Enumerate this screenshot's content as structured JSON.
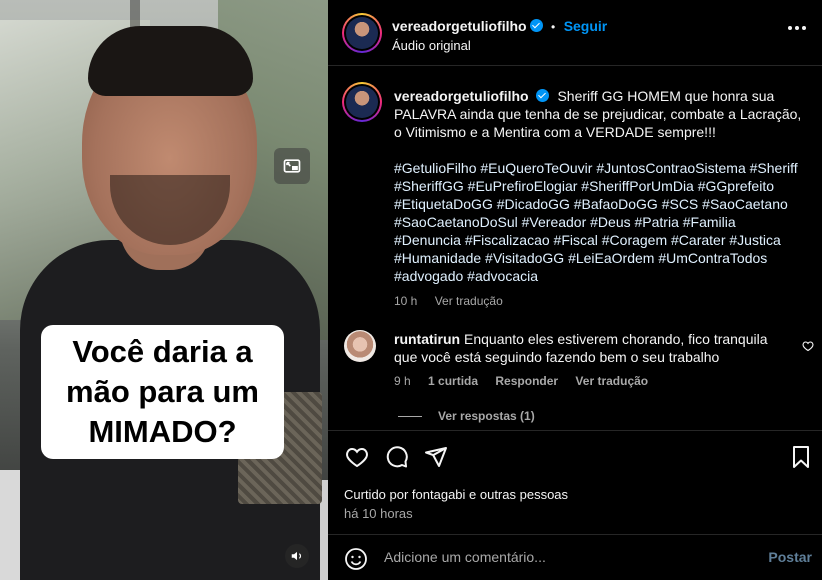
{
  "video": {
    "overlay_caption": "Você daria a\nmão para um\nMIMADO?"
  },
  "header": {
    "username": "vereadorgetuliofilho",
    "separator": "•",
    "follow_label": "Seguir",
    "audio_label": "Áudio original"
  },
  "post": {
    "username": "vereadorgetuliofilho",
    "caption": "Sheriff GG HOMEM que honra sua PALAVRA ainda que tenha de se prejudicar, combate a Lacração, o Vitimismo e a Mentira com a VERDADE sempre!!!",
    "hashtags": "#GetulioFilho #EuQueroTeOuvir #JuntosContraoSistema #Sheriff #SheriffGG #EuPrefiroElogiar #SheriffPorUmDia #GGprefeito #EtiquetaDoGG #DicadoGG #BafaoDoGG #SCS #SaoCaetano #SaoCaetanoDoSul #Vereador #Deus #Patria #Familia #Denuncia #Fiscalizacao #Fiscal #Coragem #Carater #Justica #Humanidade #VisitadoGG #LeiEaOrdem #UmContraTodos #advogado #advocacia",
    "age": "10 h",
    "translate_label": "Ver tradução"
  },
  "comment": {
    "username": "runtatirun",
    "text": "Enquanto eles estiverem chorando, fico tranquila que você está seguindo fazendo bem o seu trabalho",
    "age": "9 h",
    "likes": "1 curtida",
    "reply_label": "Responder",
    "translate_label": "Ver tradução",
    "view_replies_label": "Ver respostas (1)"
  },
  "footer": {
    "liked_by": "Curtido por fontagabi e outras pessoas",
    "time_ago": "há 10 horas",
    "comment_placeholder": "Adicione um comentário...",
    "post_label": "Postar"
  },
  "icons": {
    "pip": "picture-in-picture-icon",
    "mute": "speaker-icon",
    "more": "more-options-icon",
    "like": "heart-icon",
    "comment": "comment-icon",
    "share": "paper-plane-icon",
    "save": "bookmark-icon",
    "emoji": "emoji-icon",
    "verified": "verified-badge-icon"
  },
  "colors": {
    "accent": "#0095f6",
    "background": "#000000",
    "secondary_text": "#a8a8a8"
  }
}
